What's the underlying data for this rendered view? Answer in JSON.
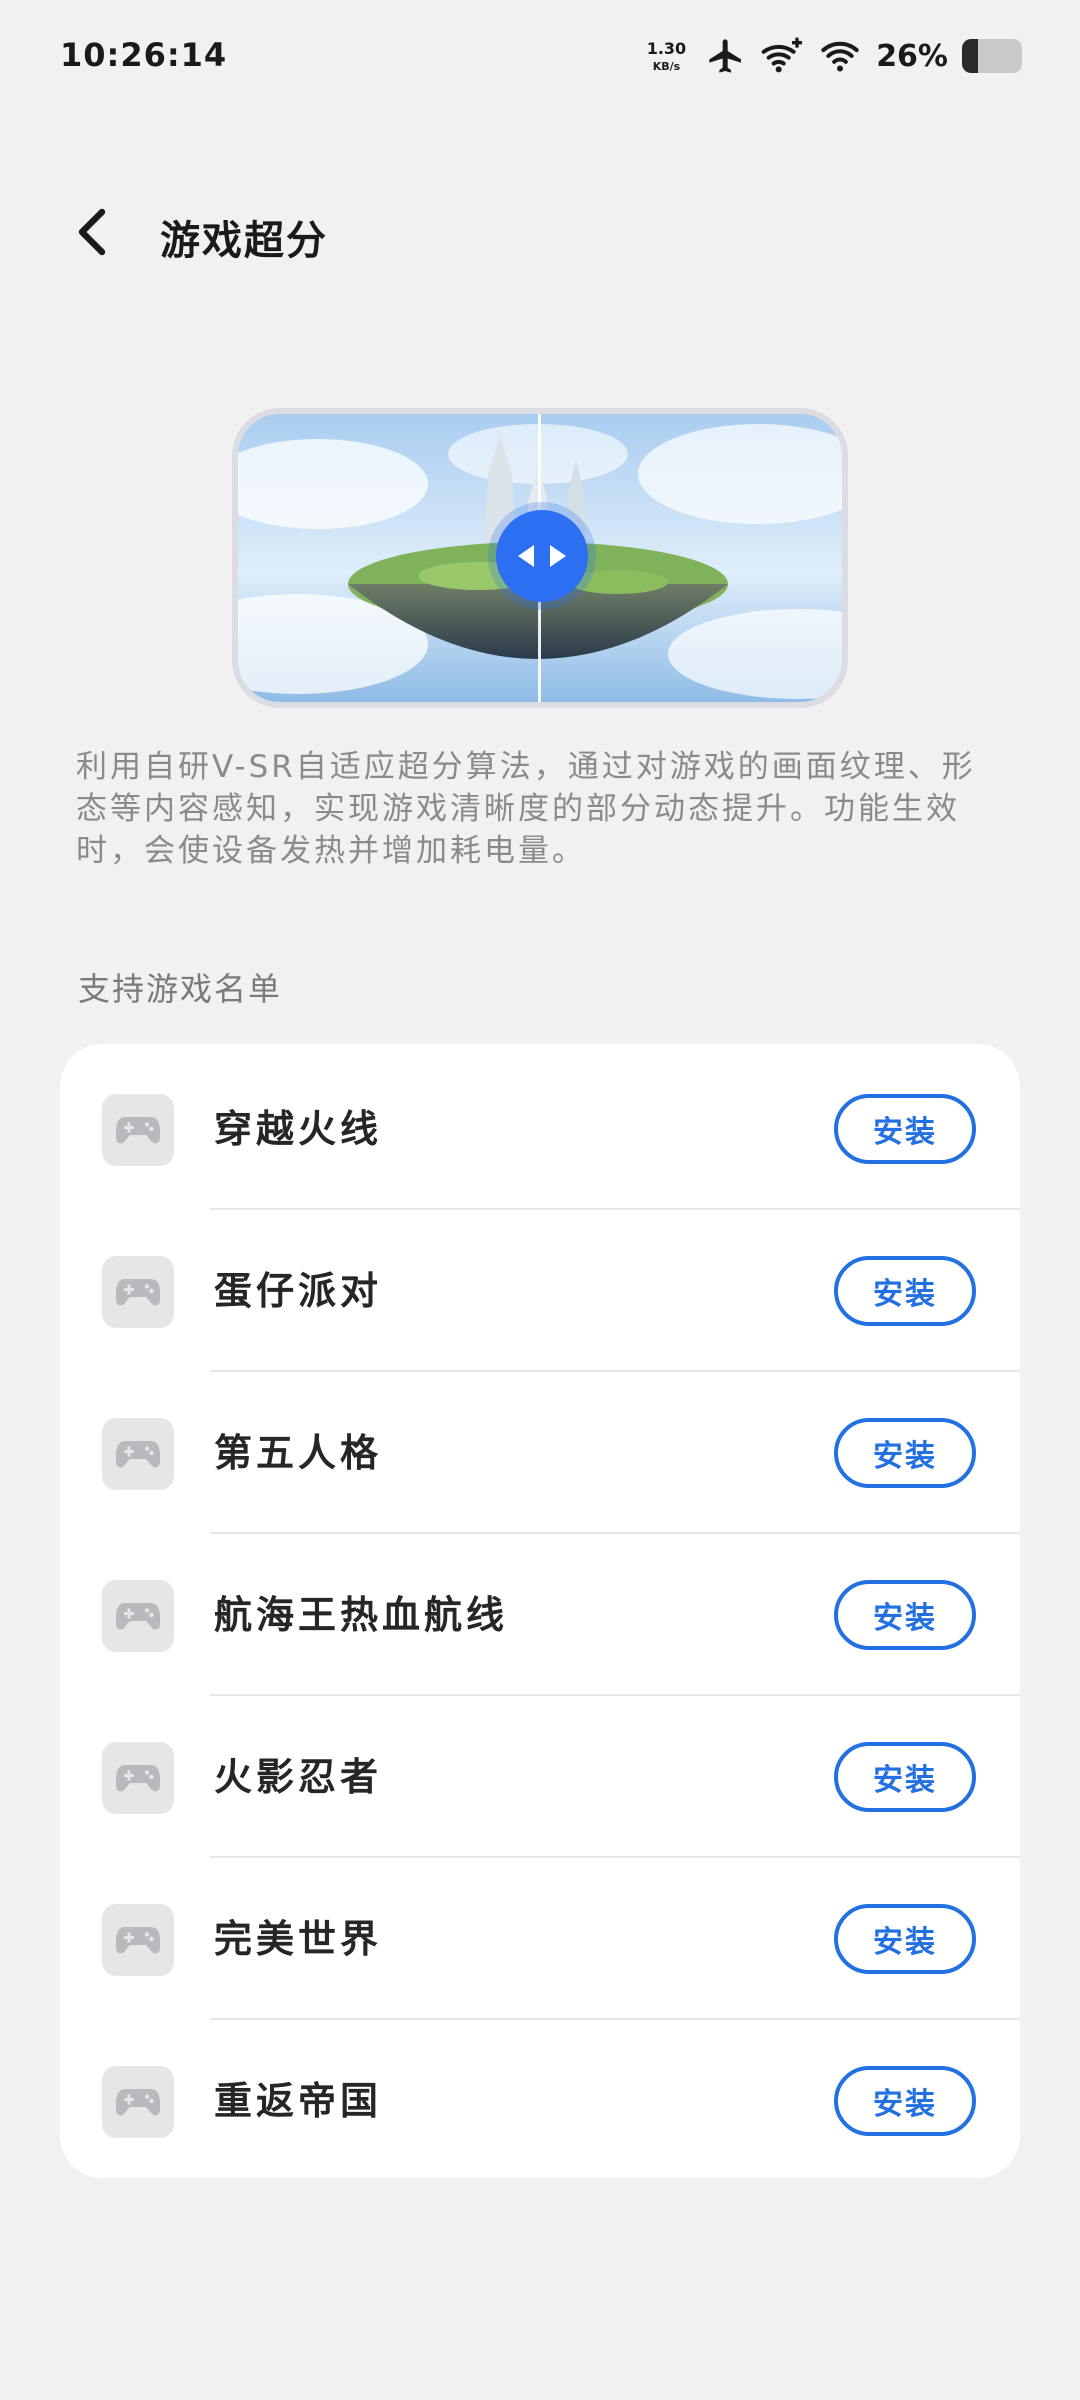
{
  "status_bar": {
    "time": "10:26:14",
    "net_speed_value": "1.30",
    "net_speed_unit": "KB/s",
    "battery_percent": "26%",
    "battery_level": 0.26,
    "icons": [
      "airplane-icon",
      "wifi-plus-icon",
      "wifi-icon",
      "battery-icon"
    ]
  },
  "header": {
    "title": "游戏超分",
    "back_icon": "chevron-left-icon"
  },
  "preview": {
    "handle_icon": "compare-arrows-icon"
  },
  "description": "利用自研V-SR自适应超分算法，通过对游戏的画面纹理、形态等内容感知，实现游戏清晰度的部分动态提升。功能生效时，会使设备发热并增加耗电量。",
  "games_section": {
    "title": "支持游戏名单",
    "install_label": "安装",
    "items": [
      {
        "name": "穿越火线",
        "icon": "gamepad-icon"
      },
      {
        "name": "蛋仔派对",
        "icon": "gamepad-icon"
      },
      {
        "name": "第五人格",
        "icon": "gamepad-icon"
      },
      {
        "name": "航海王热血航线",
        "icon": "gamepad-icon"
      },
      {
        "name": "火影忍者",
        "icon": "gamepad-icon"
      },
      {
        "name": "完美世界",
        "icon": "gamepad-icon"
      },
      {
        "name": "重返帝国",
        "icon": "gamepad-icon"
      }
    ]
  },
  "colors": {
    "accent": "#2270e2",
    "background": "#f1f1f3",
    "card": "#ffffff",
    "handle": "#2c6ff0"
  }
}
